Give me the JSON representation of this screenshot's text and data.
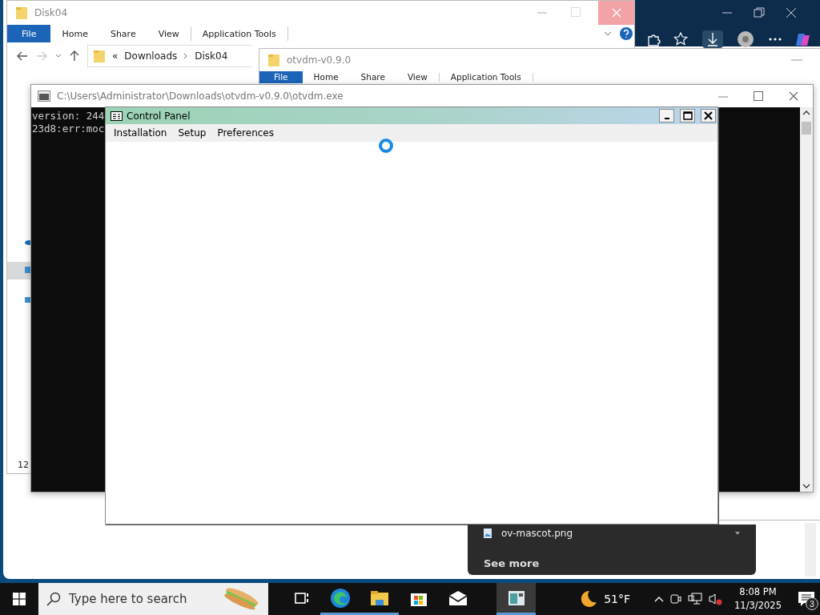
{
  "explorer_back": {
    "title": "Disk04",
    "ribbon_tabs": [
      {
        "label": "File",
        "selected": true
      },
      {
        "label": "Home",
        "selected": false
      },
      {
        "label": "Share",
        "selected": false
      },
      {
        "label": "View",
        "selected": false
      },
      {
        "label": "Application Tools",
        "selected": false
      }
    ],
    "address_overflow": "«",
    "address": [
      "Downloads",
      "Disk04"
    ],
    "nav_items": [
      {
        "kind": "cloud",
        "selected": false
      },
      {
        "kind": "pc",
        "selected": true
      },
      {
        "kind": "network",
        "selected": false
      }
    ],
    "status": "12"
  },
  "explorer_front": {
    "title": "otvdm-v0.9.0",
    "ribbon_tabs": [
      {
        "label": "File",
        "selected": true
      },
      {
        "label": "Home",
        "selected": false
      },
      {
        "label": "Share",
        "selected": false
      },
      {
        "label": "View",
        "selected": false
      },
      {
        "label": "Application Tools",
        "selected": false
      }
    ]
  },
  "console": {
    "title": "C:\\Users\\Administrator\\Downloads\\otvdm-v0.9.0\\otvdm.exe",
    "lines": [
      "version: 244",
      "23d8:err:moc"
    ]
  },
  "control_panel": {
    "title": "Control Panel",
    "menu": [
      "Installation",
      "Setup",
      "Preferences"
    ],
    "loading": true
  },
  "notification": {
    "items": [
      "ov-mascot.png"
    ],
    "link": "See more"
  },
  "taskbar": {
    "search_placeholder": "Type here to search",
    "apps": [
      {
        "kind": "task-view",
        "running": false,
        "selected": false
      },
      {
        "kind": "edge",
        "running": true,
        "selected": false
      },
      {
        "kind": "explorer",
        "running": true,
        "selected": false
      },
      {
        "kind": "store",
        "running": false,
        "selected": false
      },
      {
        "kind": "mail",
        "running": false,
        "selected": false
      },
      {
        "kind": "control-panel",
        "running": true,
        "selected": true
      }
    ],
    "weather": "51°F",
    "time": "8:08 PM",
    "date": "11/3/2025",
    "notification_count": "3"
  }
}
